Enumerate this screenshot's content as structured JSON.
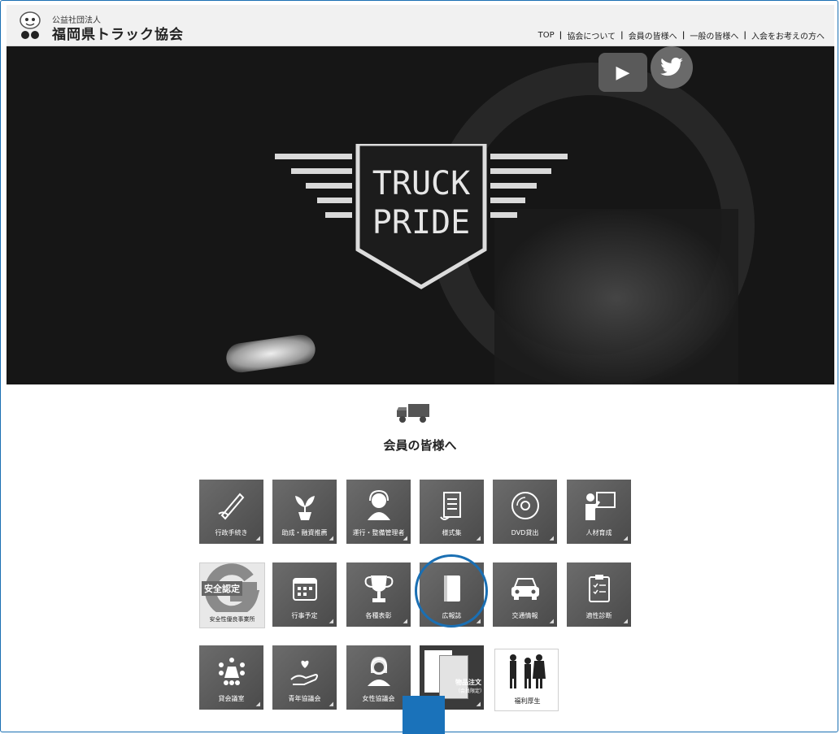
{
  "header": {
    "org_sub": "公益社団法人",
    "org_name": "福岡県トラック協会",
    "nav": [
      "TOP",
      "協会について",
      "会員の皆様へ",
      "一般の皆様へ",
      "入会をお考えの方へ"
    ]
  },
  "hero": {
    "logo_line1": "TRUCK",
    "logo_line2": "PRIDE"
  },
  "section": {
    "title": "会員の皆様へ"
  },
  "tiles": [
    {
      "label": "行政手続き",
      "icon": "pen-hand-icon"
    },
    {
      "label": "助成・融資推薦",
      "icon": "sprout-icon"
    },
    {
      "label": "運行・整備管理者",
      "icon": "operator-headset-icon"
    },
    {
      "label": "様式集",
      "icon": "scroll-document-icon"
    },
    {
      "label": "DVD貸出",
      "icon": "dvd-disc-icon"
    },
    {
      "label": "人材育成",
      "icon": "teacher-board-icon"
    },
    {
      "label": "安全性優良事業所",
      "icon": "safety-g-mark-icon",
      "badge": "安全認定"
    },
    {
      "label": "行事予定",
      "icon": "calendar-icon"
    },
    {
      "label": "各種表彰",
      "icon": "trophy-icon"
    },
    {
      "label": "広報誌",
      "icon": "book-icon"
    },
    {
      "label": "交通情報",
      "icon": "car-icon"
    },
    {
      "label": "適性診断",
      "icon": "clipboard-icon"
    },
    {
      "label": "貸会議室",
      "icon": "meeting-room-icon"
    },
    {
      "label": "青年協議会",
      "icon": "heart-hand-icon"
    },
    {
      "label": "女性協議会",
      "icon": "woman-icon"
    },
    {
      "label": "物品注文",
      "sub": "（会員限定）",
      "icon": "documents-icon"
    },
    {
      "label": "福利厚生",
      "icon": "family-icon"
    }
  ],
  "colors": {
    "accent": "#1a6fb3",
    "tile": "#5a5a5a",
    "hero_bg": "#161616"
  }
}
